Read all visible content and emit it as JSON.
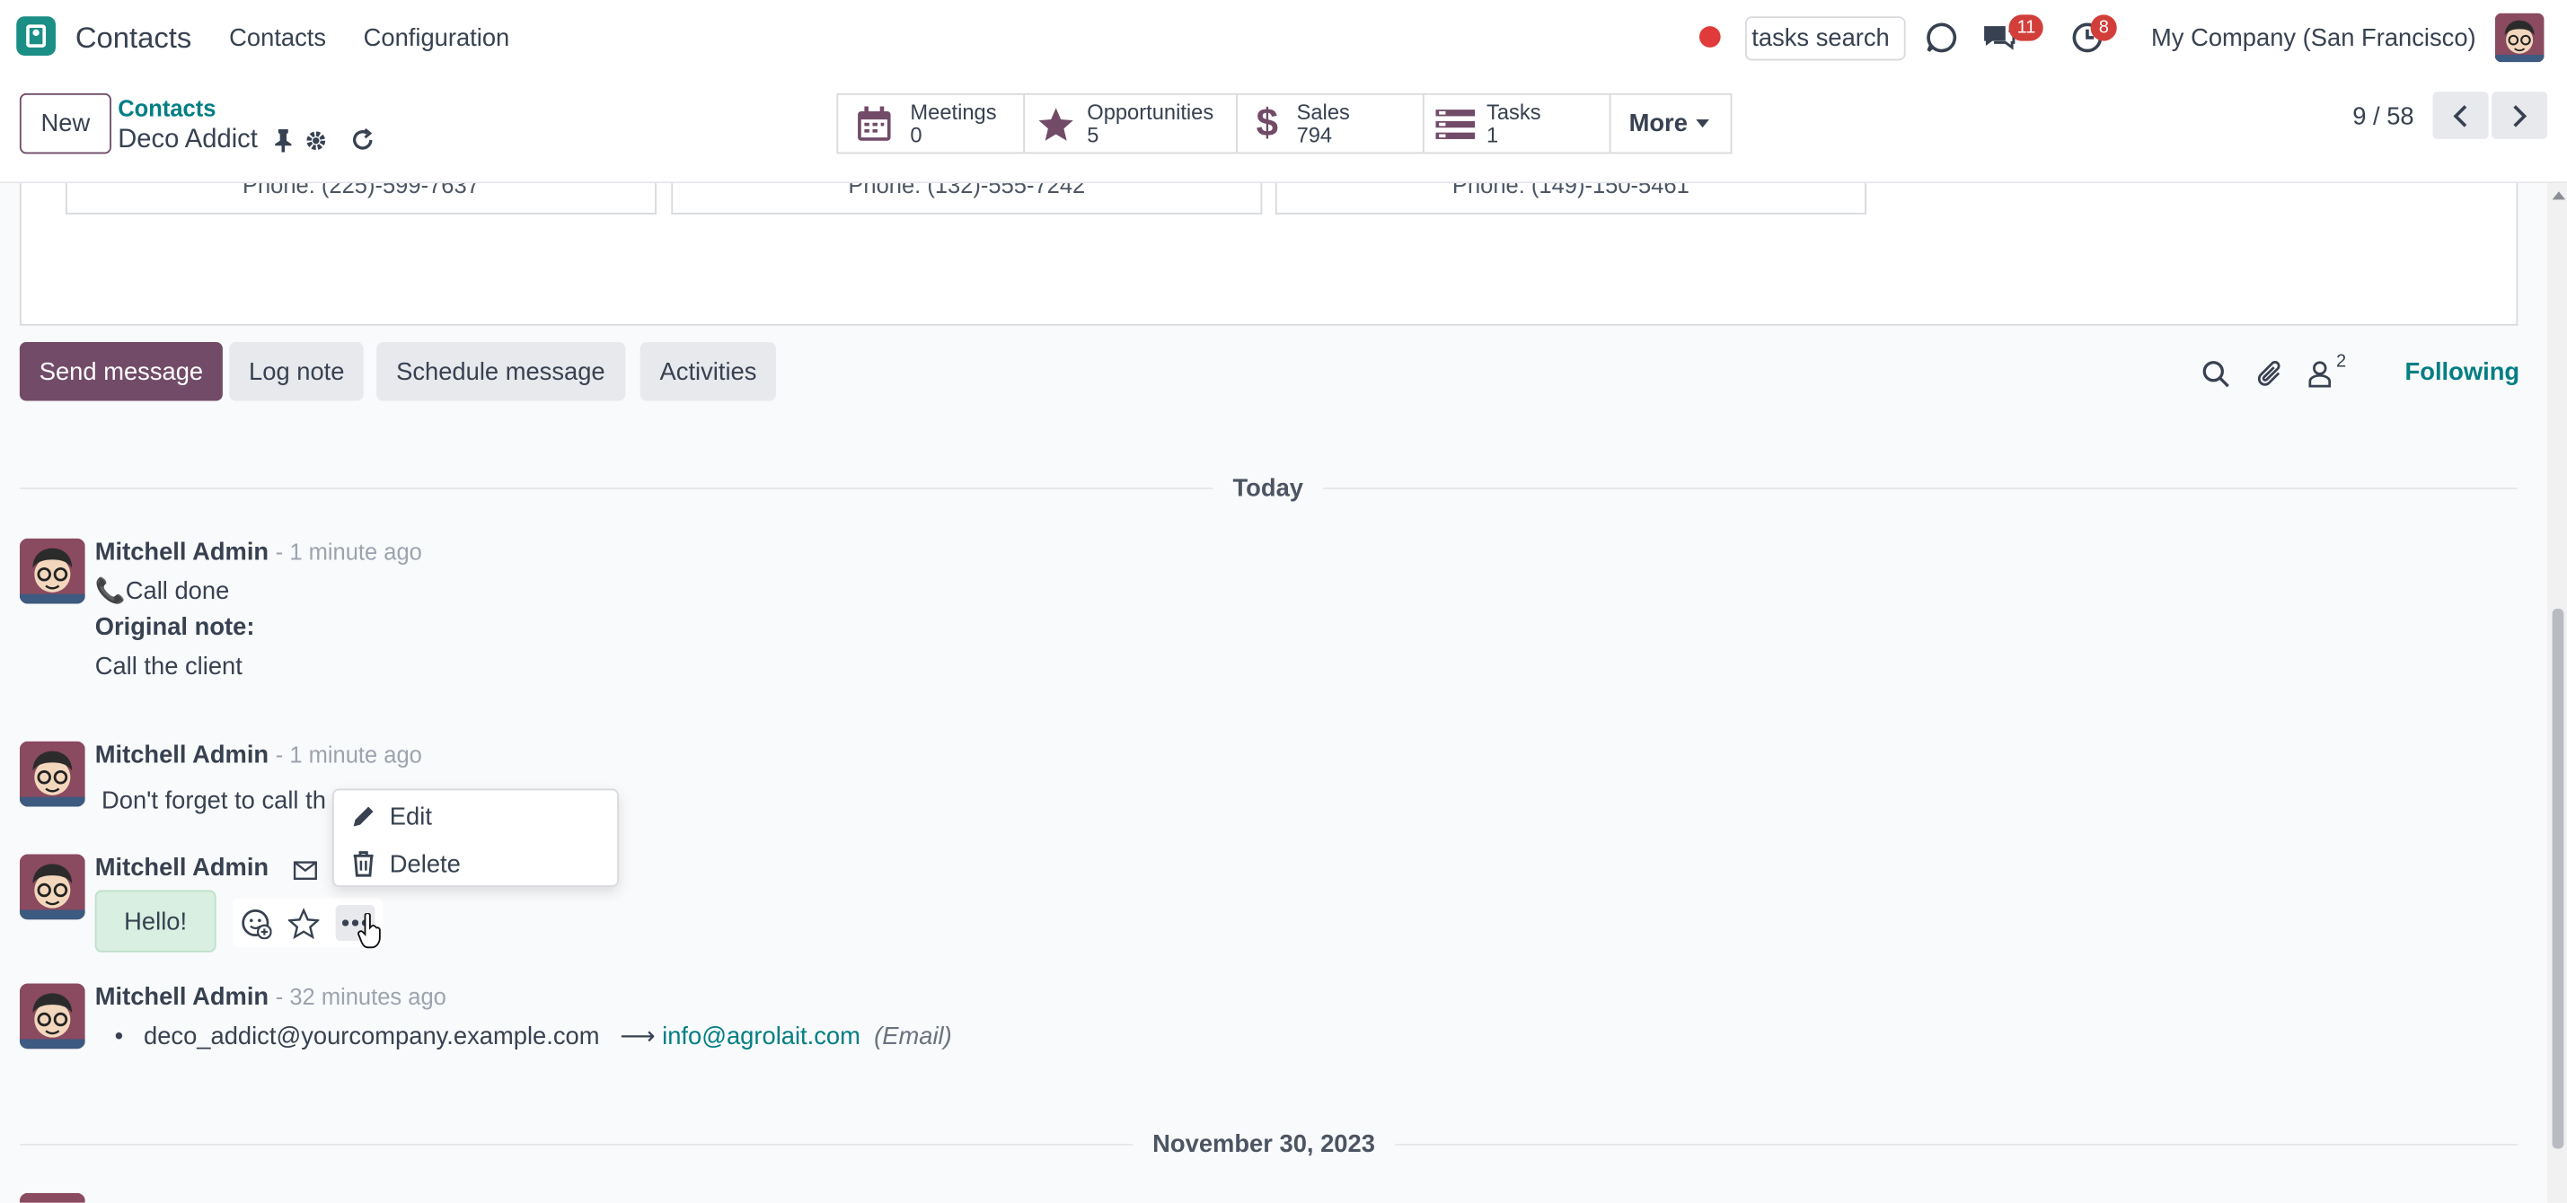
{
  "topbar": {
    "app_name": "Contacts",
    "menu": [
      "Contacts",
      "Configuration"
    ],
    "search_value": "tasks search",
    "chat_badge": "11",
    "activity_badge": "8",
    "company": "My Company (San Francisco)"
  },
  "control_panel": {
    "new_label": "New",
    "breadcrumb_parent": "Contacts",
    "record_name": "Deco Addict",
    "smart_buttons": [
      {
        "label": "Meetings",
        "value": "0",
        "icon": "calendar-icon"
      },
      {
        "label": "Opportunities",
        "value": "5",
        "icon": "star-icon"
      },
      {
        "label": "Sales",
        "value": "794",
        "icon": "dollar-icon"
      },
      {
        "label": "Tasks",
        "value": "1",
        "icon": "tasks-icon"
      }
    ],
    "more_label": "More",
    "pager": "9 / 58"
  },
  "contact_cards": [
    {
      "phone": "Phone: (225)-599-7637"
    },
    {
      "phone": "Phone: (132)-555-7242"
    },
    {
      "phone": "Phone: (149)-150-5461"
    }
  ],
  "chatter": {
    "send_message": "Send message",
    "log_note": "Log note",
    "schedule_message": "Schedule message",
    "activities": "Activities",
    "followers_count": "2",
    "following": "Following",
    "today_label": "Today",
    "date_label": "November 30, 2023",
    "messages": [
      {
        "author": "Mitchell Admin",
        "time": "- 1 minute ago",
        "line1": "Call done",
        "line2": "Original note:",
        "line3": "Call the client"
      },
      {
        "author": "Mitchell Admin",
        "time": "- 1 minute ago",
        "body": "Don't forget to call th"
      },
      {
        "author": "Mitchell Admin",
        "body": "Hello!"
      },
      {
        "author": "Mitchell Admin",
        "time": "- 32 minutes ago",
        "old_email": "deco_addict@yourcompany.example.com",
        "new_email": "info@agrolait.com",
        "field": "(Email)"
      }
    ],
    "dropdown": {
      "edit": "Edit",
      "delete": "Delete"
    }
  },
  "colors": {
    "primary": "#714b67",
    "teal": "#017e84",
    "badge": "#d23f3a"
  }
}
